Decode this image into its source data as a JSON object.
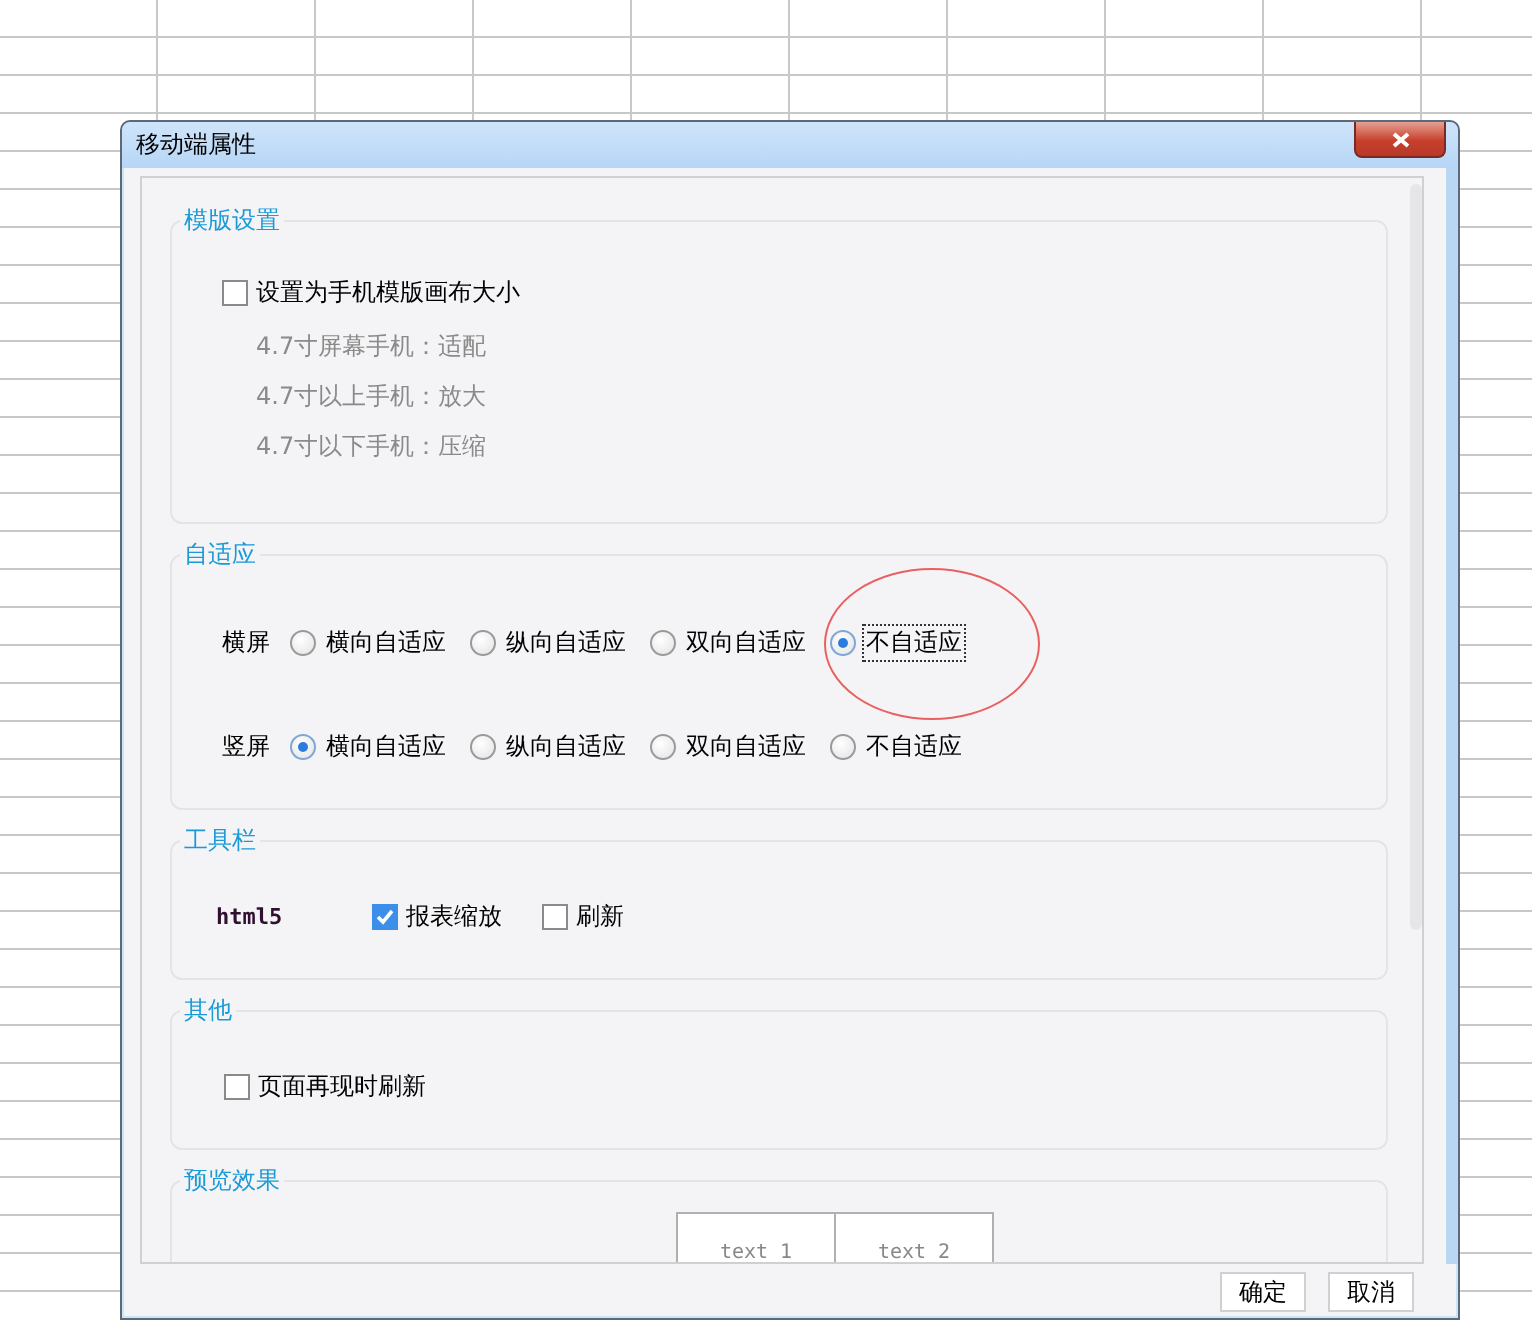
{
  "window": {
    "title": "移动端属性"
  },
  "sections": [
    {
      "kind": "template",
      "title": "模版设置",
      "checkbox": {
        "label": "设置为手机模版画布大小",
        "checked": false
      },
      "notes": [
        "4.7寸屏幕手机：适配",
        "4.7寸以上手机：放大",
        "4.7寸以下手机：压缩"
      ]
    },
    {
      "kind": "adaptive",
      "title": "自适应",
      "rows": [
        {
          "label": "横屏",
          "options": [
            {
              "label": "横向自适应",
              "selected": false,
              "focused": false
            },
            {
              "label": "纵向自适应",
              "selected": false,
              "focused": false
            },
            {
              "label": "双向自适应",
              "selected": false,
              "focused": false
            },
            {
              "label": "不自适应",
              "selected": true,
              "focused": true
            }
          ]
        },
        {
          "label": "竖屏",
          "options": [
            {
              "label": "横向自适应",
              "selected": true,
              "focused": false
            },
            {
              "label": "纵向自适应",
              "selected": false,
              "focused": false
            },
            {
              "label": "双向自适应",
              "selected": false,
              "focused": false
            },
            {
              "label": "不自适应",
              "selected": false,
              "focused": false
            }
          ]
        }
      ]
    },
    {
      "kind": "toolbar",
      "title": "工具栏",
      "tag": "html5",
      "checkboxes": [
        {
          "label": "报表缩放",
          "checked": true
        },
        {
          "label": "刷新",
          "checked": false
        }
      ]
    },
    {
      "kind": "other",
      "title": "其他",
      "checkboxes": [
        {
          "label": "页面再现时刷新",
          "checked": false
        }
      ]
    },
    {
      "kind": "preview",
      "title": "预览效果",
      "cells": [
        "text 1",
        "text 2"
      ]
    }
  ],
  "buttons": [
    "确定",
    "取消"
  ]
}
